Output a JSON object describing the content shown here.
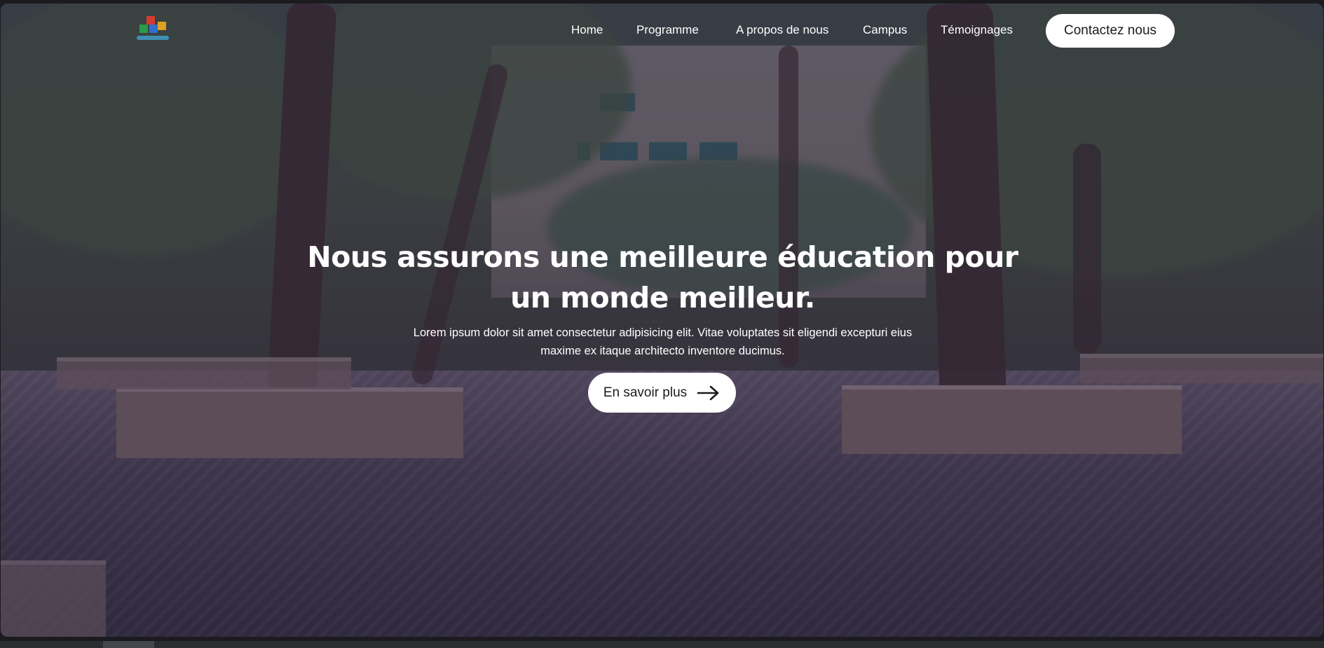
{
  "nav": {
    "logo_icon": "school-logo-icon",
    "links": [
      "Home",
      "Programme",
      "A propos de nous",
      "Campus",
      "Témoignages"
    ],
    "contact_label": "Contactez nous"
  },
  "hero": {
    "headline_line1": "Nous assurons une meilleure éducation pour",
    "headline_line2": "un monde meilleur.",
    "subtitle_line1": "Lorem ipsum dolor sit amet consectetur adipisicing elit. Vitae voluptates sit eligendi excepturi eius",
    "subtitle_line2": "maxime ex itaque architecto inventore ducimus.",
    "cta_label": "En savoir plus",
    "cta_icon": "arrow-right-icon",
    "background_image": "campus-courtyard-photo"
  },
  "colors": {
    "overlay": "#2d2346",
    "button_bg": "#ffffff",
    "text_light": "#ffffff"
  }
}
